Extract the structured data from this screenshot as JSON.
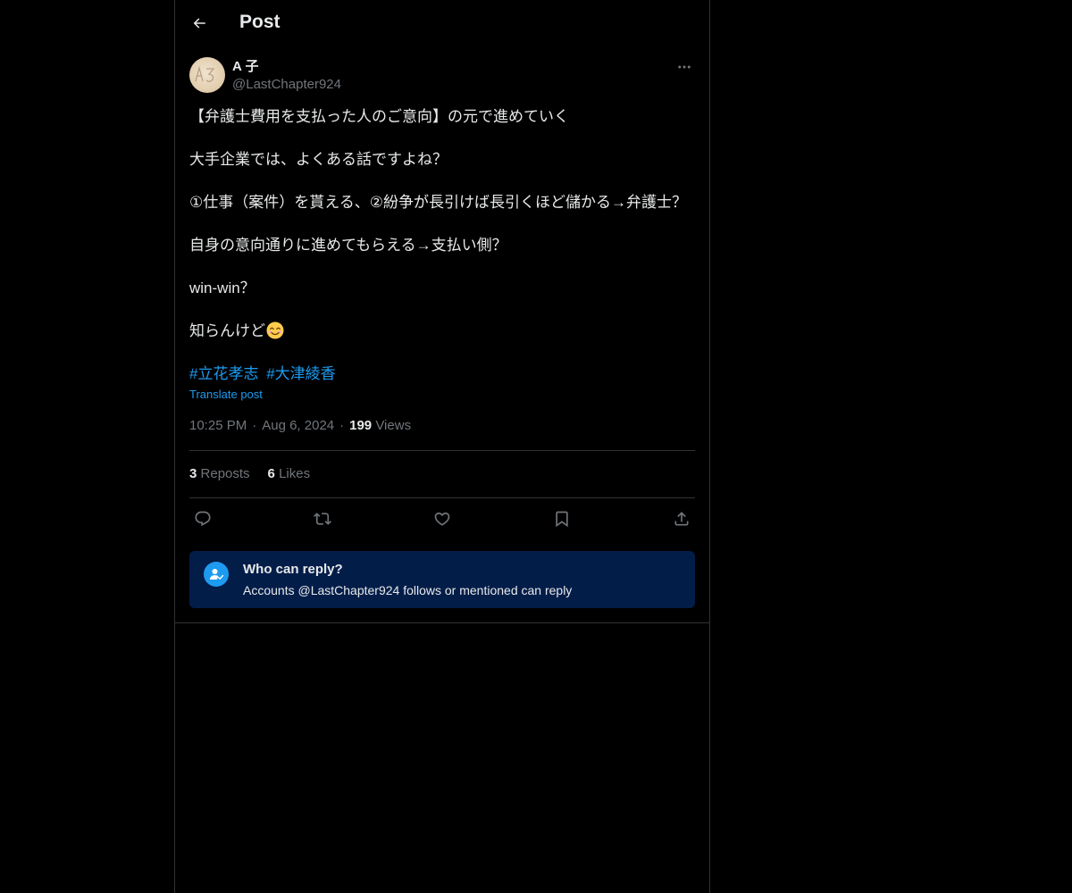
{
  "header": {
    "back_icon": "arrow-left-icon",
    "title": "Post"
  },
  "author": {
    "avatar_text": "A子",
    "display_name": "A 子",
    "handle": "@LastChapter924",
    "more_icon": "ellipsis-icon"
  },
  "post": {
    "paragraphs": [
      "【弁護士費用を支払った人のご意向】の元で進めていく",
      "大手企業では、よくある話ですよね？",
      "①仕事（案件）を貰える、②紛争が長引けば長引くほど儲かる→弁護士？",
      "自身の意向通りに進めてもらえる→支払い側？",
      "win-win？",
      "知らんけど"
    ],
    "emoji": "smiling-face-emoji",
    "hashtags": [
      "#立花孝志",
      "#大津綾香"
    ],
    "translate_label": "Translate post",
    "time": "10:25 PM",
    "date": "Aug 6, 2024",
    "views_count": "199",
    "views_label": "Views"
  },
  "stats": {
    "reposts_count": "3",
    "reposts_label": "Reposts",
    "likes_count": "6",
    "likes_label": "Likes"
  },
  "actions": {
    "reply_icon": "reply-icon",
    "repost_icon": "repost-icon",
    "like_icon": "heart-icon",
    "bookmark_icon": "bookmark-icon",
    "share_icon": "share-icon"
  },
  "reply_restriction": {
    "icon": "person-check-icon",
    "title": "Who can reply?",
    "subtitle": "Accounts @LastChapter924 follows or mentioned can reply"
  },
  "colors": {
    "background": "#000000",
    "text": "#e7e9ea",
    "muted": "#71767b",
    "accent": "#1d9bf0",
    "border": "#2f3336",
    "reply_box": "#031d49"
  }
}
